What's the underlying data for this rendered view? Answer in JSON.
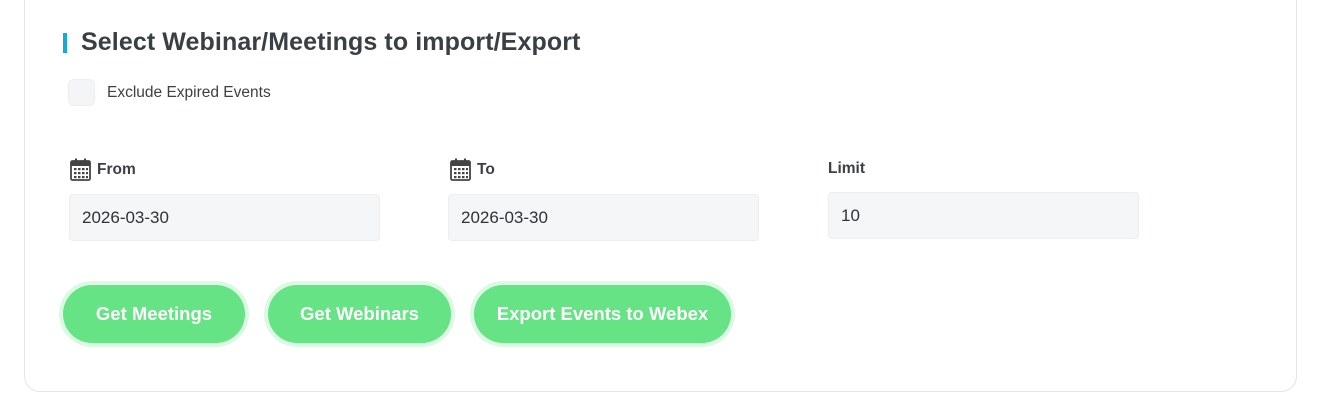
{
  "section": {
    "title": "Select Webinar/Meetings to import/Export",
    "accent_color": "#17a8d9"
  },
  "exclude_expired": {
    "label": "Exclude Expired Events",
    "checked": false
  },
  "from": {
    "label": "From",
    "icon": "calendar-icon",
    "value": "2026-03-30"
  },
  "to": {
    "label": "To",
    "icon": "calendar-icon",
    "value": "2026-03-30"
  },
  "limit": {
    "label": "Limit",
    "value": "10"
  },
  "buttons": {
    "get_meetings": "Get Meetings",
    "get_webinars": "Get Webinars",
    "export_events": "Export Events to Webex",
    "color": "#66e385"
  }
}
